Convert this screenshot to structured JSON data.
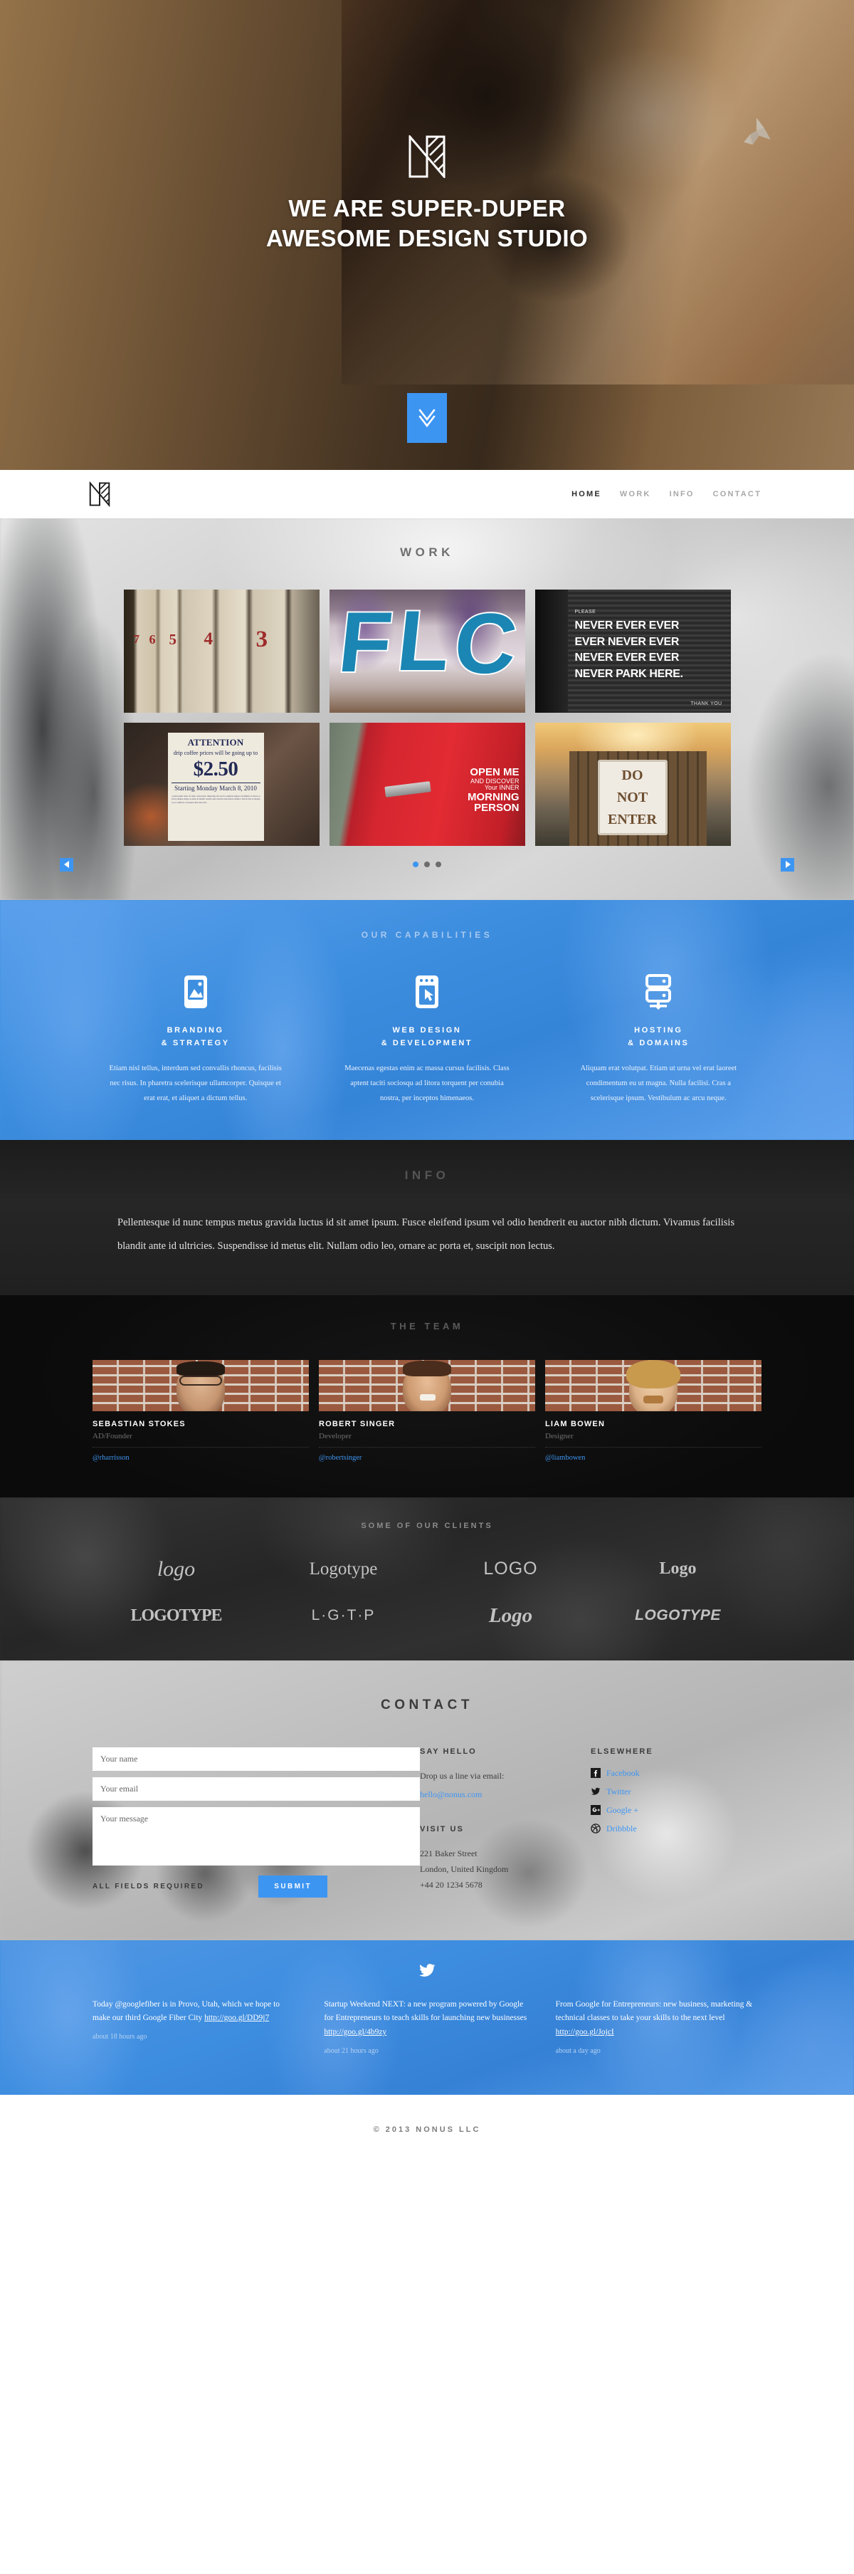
{
  "hero": {
    "logo_icon": "nonus-monogram-logo",
    "title_line1": "WE ARE SUPER-DUPER",
    "title_line2": "AWESOME DESIGN STUDIO",
    "scroll_icon": "double-chevron-down-icon"
  },
  "nav": {
    "logo_icon": "nonus-monogram-logo",
    "links": [
      {
        "label": "HOME",
        "active": true
      },
      {
        "label": "WORK",
        "active": false
      },
      {
        "label": "INFO",
        "active": false
      },
      {
        "label": "CONTACT",
        "active": false
      }
    ]
  },
  "work": {
    "title": "WORK",
    "items": [
      {
        "name": "numbered-doors-photo",
        "caption": "7 6 5 4 3"
      },
      {
        "name": "graffiti-letters-photo",
        "caption": "FL"
      },
      {
        "name": "never-park-here-sign-photo",
        "please": "PLEASE",
        "lines": [
          "NEVER EVER EVER",
          "EVER NEVER EVER",
          "NEVER EVER EVER",
          "NEVER PARK HERE."
        ],
        "thanks": "THANK YOU"
      },
      {
        "name": "coffee-price-poster-photo",
        "p1": "ATTENTION",
        "p2": "drip coffee prices will be going up to",
        "p3": "$2.50",
        "p4": "Starting Monday March 8, 2010"
      },
      {
        "name": "red-door-open-me-photo",
        "l1": "OPEN ME",
        "l2": "AND DISCOVER",
        "l3": "Your INNER",
        "l4": "MORNING",
        "l5": "PERSON"
      },
      {
        "name": "do-not-enter-sign-photo",
        "lines": [
          "DO",
          "NOT",
          "ENTER"
        ]
      }
    ],
    "carousel": {
      "prev_icon": "chevron-left-icon",
      "next_icon": "chevron-right-icon",
      "dots": 3,
      "active_dot": 0
    }
  },
  "capabilities": {
    "title": "OUR CAPABILITIES",
    "items": [
      {
        "icon": "image-icon",
        "name_line1": "BRANDING",
        "name_line2": "& STRATEGY",
        "desc": "Etiam nisl tellus, interdum sed convallis rhoncus, facilisis nec risus. In pharetra scelerisque ullamcorper. Quisque et erat erat, et aliquet a dictum tellus."
      },
      {
        "icon": "browser-window-cursor-icon",
        "name_line1": "WEB DESIGN",
        "name_line2": "& DEVELOPMENT",
        "desc": "Maecenas egestas enim ac massa cursus facilisis. Class aptent taciti sociosqu ad litora torquent per conubia nostra, per inceptos himenaeos."
      },
      {
        "icon": "server-rack-icon",
        "name_line1": "HOSTING",
        "name_line2": "& DOMAINS",
        "desc": "Aliquam erat volutpat. Etiam ut urna vel erat laoreet condimentum eu ut magna. Nulla facilisi. Cras a scelerisque ipsum. Vestibulum ac arcu neque."
      }
    ]
  },
  "info": {
    "title": "INFO",
    "body": "Pellentesque id nunc tempus metus gravida luctus id sit amet ipsum. Fusce eleifend ipsum vel odio hendrerit eu auctor nibh dictum. Vivamus facilisis blandit ante id ultricies. Suspendisse id metus elit. Nullam odio leo, ornare ac porta et, suscipit non lectus."
  },
  "team": {
    "title": "THE TEAM",
    "members": [
      {
        "photo": "team-photo-sebastian",
        "name": "SEBASTIAN STOKES",
        "role": "AD/Founder",
        "handle": "@rharrisson"
      },
      {
        "photo": "team-photo-robert",
        "name": "ROBERT SINGER",
        "role": "Developer",
        "handle": "@robertsinger"
      },
      {
        "photo": "team-photo-liam",
        "name": "LIAM BOWEN",
        "role": "Designer",
        "handle": "@liambowen"
      }
    ]
  },
  "clients": {
    "title": "SOME OF OUR CLIENTS",
    "logos": [
      "logo",
      "Logotype",
      "LOGO",
      "Logo",
      "LOGOTYPE",
      "L·G·T·P",
      "Logo",
      "LOGOTYPE"
    ]
  },
  "contact": {
    "title": "CONTACT",
    "form": {
      "name_placeholder": "Your name",
      "name_value": "",
      "email_placeholder": "Your email",
      "email_value": "",
      "message_placeholder": "Your message",
      "message_value": "",
      "required_note": "ALL FIELDS REQUIRED",
      "submit_label": "SUBMIT"
    },
    "say_hello": {
      "heading": "SAY HELLO",
      "text": "Drop us a line via email:",
      "email": "hello@nonus.com"
    },
    "visit_us": {
      "heading": "VISIT US",
      "line1": "221 Baker Street",
      "line2": "London, United Kingdom",
      "line3": "+44 20 1234 5678"
    },
    "elsewhere": {
      "heading": "ELSEWHERE",
      "links": [
        {
          "icon": "facebook-icon",
          "label": "Facebook"
        },
        {
          "icon": "twitter-icon",
          "label": "Twitter"
        },
        {
          "icon": "google-plus-icon",
          "label": "Google +"
        },
        {
          "icon": "dribbble-icon",
          "label": "Dribbble"
        }
      ]
    }
  },
  "tweets": {
    "icon": "twitter-bird-icon",
    "items": [
      {
        "text": "Today @googlefiber is in Provo, Utah, which we hope to make our third Google Fiber City ",
        "link": "http://goo.gl/DD9j7",
        "time": "about 18 hours ago"
      },
      {
        "text": "Startup Weekend NEXT: a new program powered by Google for Entrepreneurs to teach skills for launching new businesses ",
        "link": "http://goo.gl/4b9zy",
        "time": "about 21 hours ago"
      },
      {
        "text": "From Google for Entrepreneurs: new business, marketing & technical classes to take your skills to the next level ",
        "link": "http://goo.gl/JojcI",
        "time": "about a day ago"
      }
    ]
  },
  "footer": {
    "copyright": "© 2013 NONUS LLC"
  },
  "colors": {
    "accent": "#3d95f2",
    "dark": "#1c1c1c",
    "muted": "#6f6f6f"
  }
}
